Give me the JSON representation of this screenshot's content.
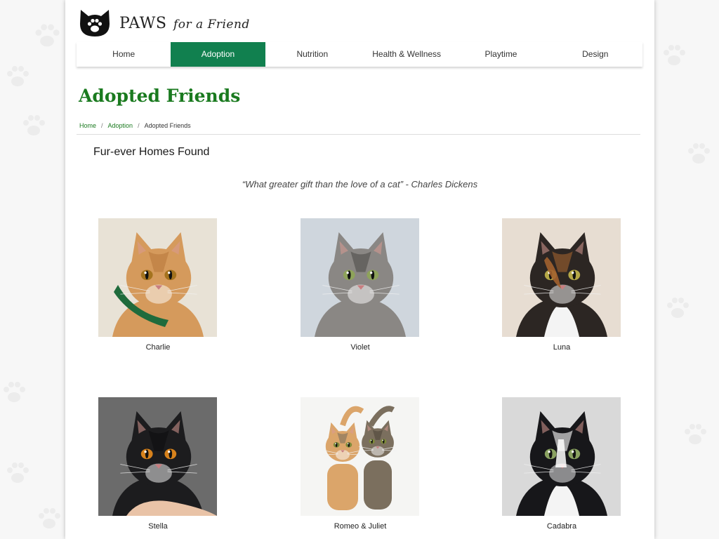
{
  "brand": {
    "name_main": "PAWS",
    "name_rest": "for a Friend",
    "logo_icon": "cat-paw-logo-icon",
    "accent_color": "#11804f",
    "title_color": "#1a7a1f"
  },
  "nav": {
    "items": [
      {
        "label": "Home",
        "active": false
      },
      {
        "label": "Adoption",
        "active": true
      },
      {
        "label": "Nutrition",
        "active": false
      },
      {
        "label": "Health & Wellness",
        "active": false
      },
      {
        "label": "Playtime",
        "active": false
      },
      {
        "label": "Design",
        "active": false
      }
    ]
  },
  "page": {
    "title": "Adopted Friends",
    "breadcrumb": [
      "Home",
      "Adoption",
      "Adopted Friends"
    ],
    "section_heading": "Fur-ever Homes Found",
    "quote": "“What greater gift than the love of a cat” - Charles Dickens"
  },
  "cats": [
    {
      "name": "Charlie",
      "fur": "#d59a5c",
      "fur_dark": "#b97a3c",
      "eyes": "#a5731e",
      "bg": "#e8e2d6"
    },
    {
      "name": "Violet",
      "fur": "#8a8784",
      "fur_dark": "#4f4c49",
      "eyes": "#8ea35a",
      "bg": "#cfd6dd"
    },
    {
      "name": "Luna",
      "fur": "#2c2623",
      "fur_dark": "#a2622f",
      "eyes": "#b5a846",
      "bg": "#e7ddd2"
    },
    {
      "name": "Stella",
      "fur": "#1c1c1e",
      "fur_dark": "#0d0d0f",
      "eyes": "#d7821c",
      "bg": "#6b6b6b"
    },
    {
      "name": "Romeo & Juliet",
      "fur": "#dba56a",
      "fur_dark": "#7b6f5e",
      "eyes": "#7e8a3a",
      "bg": "#f5f5f3"
    },
    {
      "name": "Cadabra",
      "fur": "#17171a",
      "fur_dark": "#ffffff",
      "eyes": "#8aa261",
      "bg": "#d9d9d9"
    }
  ]
}
